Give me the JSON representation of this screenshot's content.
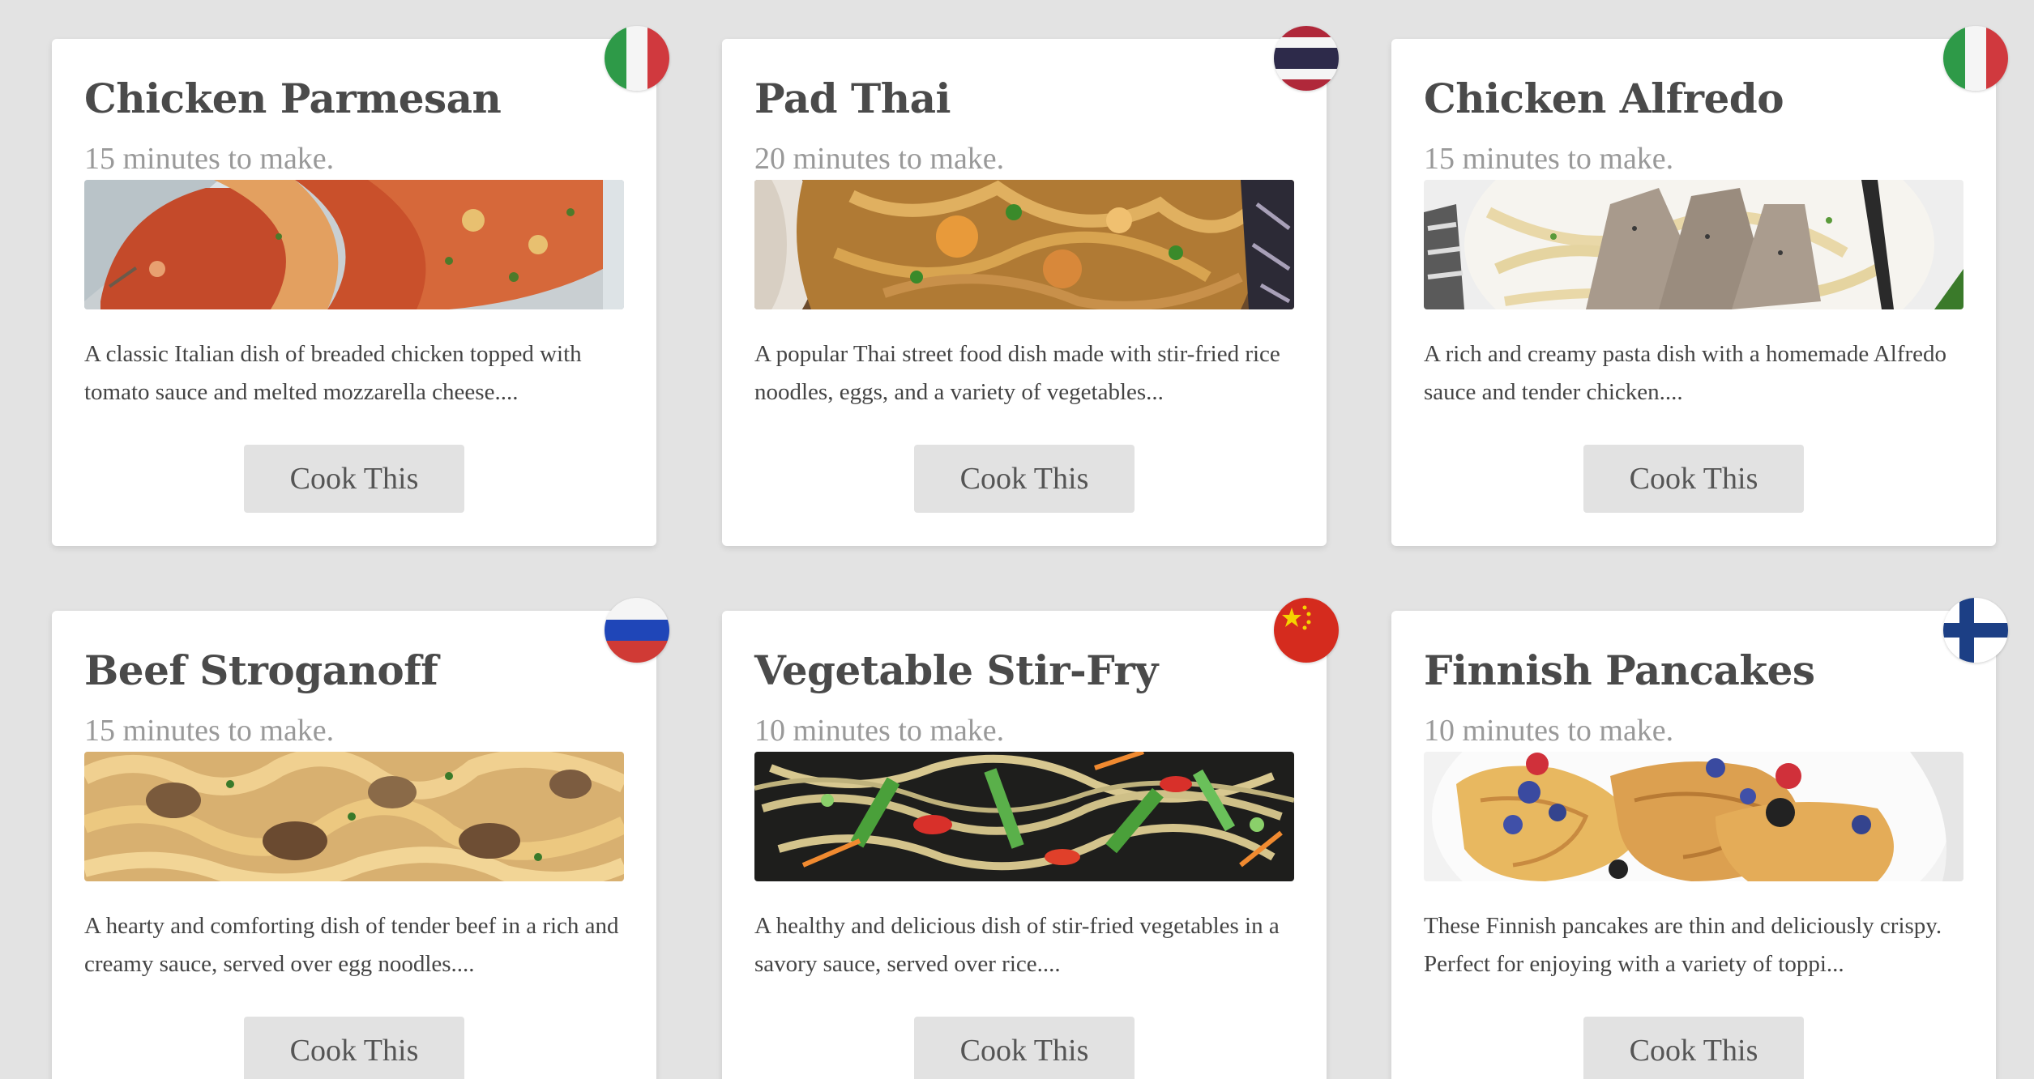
{
  "recipes": [
    {
      "title": "Chicken Parmesan",
      "time": "15 minutes to make.",
      "description": "A classic Italian dish of breaded chicken topped with tomato sauce and melted mozzarella cheese....",
      "button_label": "Cook This",
      "flag": "italy-flag-icon",
      "image": "chicken-parmesan-photo"
    },
    {
      "title": "Pad Thai",
      "time": "20 minutes to make.",
      "description": "A popular Thai street food dish made with stir-fried rice noodles, eggs, and a variety of vegetables...",
      "button_label": "Cook This",
      "flag": "thailand-flag-icon",
      "image": "pad-thai-photo"
    },
    {
      "title": "Chicken Alfredo",
      "time": "15 minutes to make.",
      "description": "A rich and creamy pasta dish with a homemade Alfredo sauce and tender chicken....",
      "button_label": "Cook This",
      "flag": "italy-flag-icon",
      "image": "chicken-alfredo-photo"
    },
    {
      "title": "Beef Stroganoff",
      "time": "15 minutes to make.",
      "description": "A hearty and comforting dish of tender beef in a rich and creamy sauce, served over egg noodles....",
      "button_label": "Cook This",
      "flag": "russia-flag-icon",
      "image": "beef-stroganoff-photo"
    },
    {
      "title": "Vegetable Stir-Fry",
      "time": "10 minutes to make.",
      "description": "A healthy and delicious dish of stir-fried vegetables in a savory sauce, served over rice....",
      "button_label": "Cook This",
      "flag": "china-flag-icon",
      "image": "vegetable-stir-fry-photo"
    },
    {
      "title": "Finnish Pancakes",
      "time": "10 minutes to make.",
      "description": "These Finnish pancakes are thin and deliciously crispy. Perfect for enjoying with a variety of toppi...",
      "button_label": "Cook This",
      "flag": "finland-flag-icon",
      "image": "finnish-pancakes-photo"
    }
  ],
  "colors": {
    "page_background": "#e3e3e3",
    "card_background": "#ffffff",
    "title_text": "#4a4a4a",
    "time_text": "#999999",
    "button_background": "#e2e2e2"
  }
}
